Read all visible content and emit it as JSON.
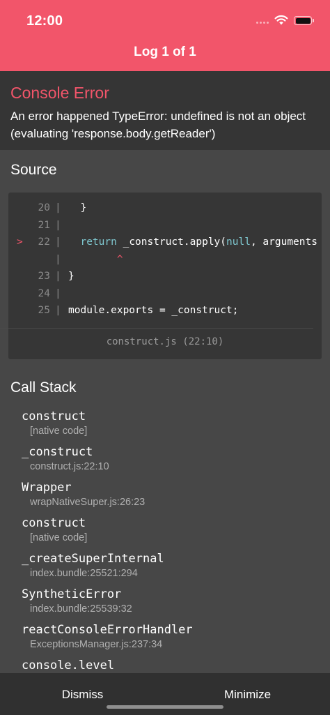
{
  "status_bar": {
    "time": "12:00"
  },
  "header": {
    "title": "Log 1 of 1"
  },
  "error": {
    "title": "Console Error",
    "message": "An error happened TypeError: undefined is not an object (evaluating 'response.body.getReader')"
  },
  "source": {
    "heading": "Source",
    "lines": [
      {
        "number": "20",
        "marker": "",
        "code": "  }"
      },
      {
        "number": "21",
        "marker": "",
        "code": ""
      },
      {
        "number": "22",
        "marker": ">",
        "code_parts": [
          {
            "text": "  ",
            "kind": "plain"
          },
          {
            "text": "return",
            "kind": "keyword"
          },
          {
            "text": " _construct.",
            "kind": "plain"
          },
          {
            "text": "apply",
            "kind": "plain"
          },
          {
            "text": "(",
            "kind": "plain"
          },
          {
            "text": "null",
            "kind": "null"
          },
          {
            "text": ", arguments",
            "kind": "plain"
          }
        ]
      },
      {
        "number": "",
        "marker": "",
        "caret": "        ^"
      },
      {
        "number": "23",
        "marker": "",
        "code": "}"
      },
      {
        "number": "24",
        "marker": "",
        "code": ""
      },
      {
        "number": "25",
        "marker": "",
        "code": "module.exports = _construct;"
      }
    ],
    "file": "construct.js (22:10)"
  },
  "call_stack": {
    "heading": "Call Stack",
    "frames": [
      {
        "name": "construct",
        "location": "[native code]"
      },
      {
        "name": "_construct",
        "location": "construct.js:22:10"
      },
      {
        "name": "Wrapper",
        "location": "wrapNativeSuper.js:26:23"
      },
      {
        "name": "construct",
        "location": "[native code]"
      },
      {
        "name": "_createSuperInternal",
        "location": "index.bundle:25521:294"
      },
      {
        "name": "SyntheticError",
        "location": "index.bundle:25539:32"
      },
      {
        "name": "reactConsoleErrorHandler",
        "location": "ExceptionsManager.js:237:34"
      },
      {
        "name": "console.level",
        "location": ""
      }
    ]
  },
  "footer": {
    "dismiss_label": "Dismiss",
    "minimize_label": "Minimize"
  },
  "colors": {
    "accent": "#f2556a",
    "background": "#474747",
    "panel": "#353535",
    "footer": "#303030"
  },
  "icons": [
    "wifi-icon",
    "battery-icon",
    "cellular-signal-icon"
  ]
}
